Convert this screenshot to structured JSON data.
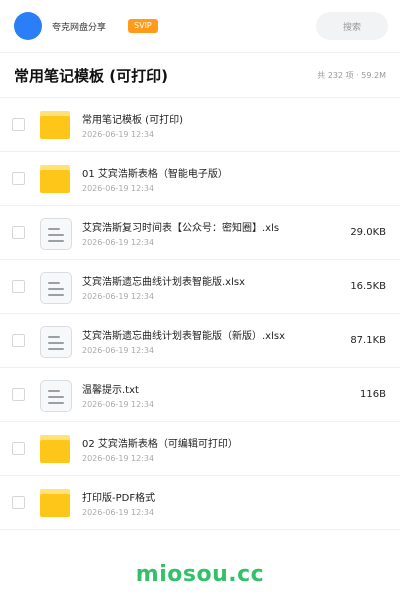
{
  "header": {
    "app_name": "夸克网盘分享",
    "badge": "SVIP",
    "search_label": "搜索"
  },
  "folder": {
    "title": "常用笔记模板 (可打印)",
    "meta": "共 232 项 · 59.2M"
  },
  "files": [
    {
      "name": "常用笔记模板 (可打印)",
      "date": "2026-06-19 12:34",
      "size": "",
      "type": "folder"
    },
    {
      "name": "01 艾宾浩斯表格（智能电子版）",
      "date": "2026-06-19 12:34",
      "size": "",
      "type": "folder"
    },
    {
      "name": "艾宾浩斯复习时间表【公众号：密知圈】.xls",
      "date": "2026-06-19 12:34",
      "size": "29.0KB",
      "type": "document"
    },
    {
      "name": "艾宾浩斯遗忘曲线计划表智能版.xlsx",
      "date": "2026-06-19 12:34",
      "size": "16.5KB",
      "type": "document"
    },
    {
      "name": "艾宾浩斯遗忘曲线计划表智能版（新版）.xlsx",
      "date": "2026-06-19 12:34",
      "size": "87.1KB",
      "type": "document"
    },
    {
      "name": "温馨提示.txt",
      "date": "2026-06-19 12:34",
      "size": "116B",
      "type": "document"
    },
    {
      "name": "02 艾宾浩斯表格（可编辑可打印）",
      "date": "2026-06-19 12:34",
      "size": "",
      "type": "folder"
    },
    {
      "name": "打印版-PDF格式",
      "date": "2026-06-19 12:34",
      "size": "",
      "type": "folder"
    }
  ],
  "watermark": "miosou.cc",
  "colors": {
    "accent": "#2a7ff6",
    "badge": "#ff9a1a",
    "folder": "#ffc61a",
    "watermark": "#34c06a"
  }
}
